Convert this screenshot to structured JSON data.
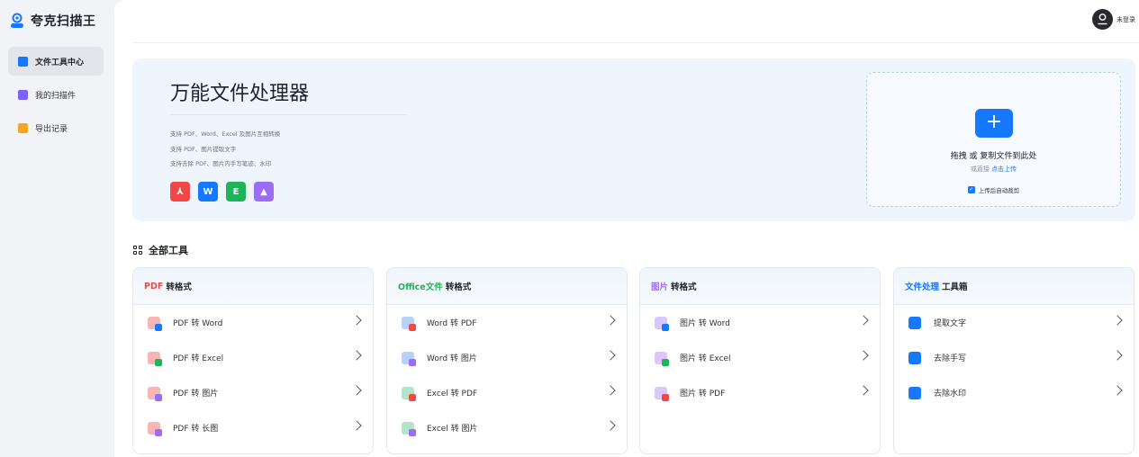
{
  "app": {
    "name": "夸克扫描王"
  },
  "sidebar": {
    "items": [
      {
        "label": "文件工具中心",
        "icon": "briefcase-icon",
        "active": true,
        "color": "#1677ff"
      },
      {
        "label": "我的扫描件",
        "icon": "document-icon",
        "active": false,
        "color": "#7b61ff"
      },
      {
        "label": "导出记录",
        "icon": "folder-icon",
        "active": false,
        "color": "#f5a623"
      }
    ]
  },
  "header": {
    "login_label": "未登录"
  },
  "hero": {
    "title": "万能文件处理器",
    "lines": [
      "支持 PDF、Word、Excel 及图片互相转换",
      "支持 PDF、图片提取文字",
      "支持去除 PDF、图片内手写笔迹、水印"
    ],
    "file_icons": [
      {
        "name": "pdf-icon",
        "glyph": "⅄",
        "color": "#f04848"
      },
      {
        "name": "word-icon",
        "glyph": "W",
        "color": "#1677ff"
      },
      {
        "name": "excel-icon",
        "glyph": "E",
        "color": "#1fb35a"
      },
      {
        "name": "image-icon",
        "glyph": "▲",
        "color": "#9b6cf5"
      }
    ]
  },
  "upload": {
    "main": "拖拽 或 复制文件到此处",
    "sub_prefix": "或直接 ",
    "sub_link": "点击上传",
    "checkbox_label": "上传后自动裁剪",
    "checked": true
  },
  "section": {
    "title": "全部工具"
  },
  "cards": [
    {
      "prefix": "PDF",
      "prefix_color": "#f04848",
      "suffix": "转格式",
      "items": [
        {
          "label": "PDF 转 Word",
          "icon": "pdf-to-word-icon",
          "base": "#f9b4b4",
          "sub": "#1677ff"
        },
        {
          "label": "PDF 转 Excel",
          "icon": "pdf-to-excel-icon",
          "base": "#f9b4b4",
          "sub": "#1fb35a"
        },
        {
          "label": "PDF 转 图片",
          "icon": "pdf-to-image-icon",
          "base": "#f9b4b4",
          "sub": "#9b6cf5"
        },
        {
          "label": "PDF 转 长图",
          "icon": "pdf-to-long-image-icon",
          "base": "#f9b4b4",
          "sub": "#9b6cf5"
        }
      ]
    },
    {
      "prefix": "Office文件",
      "prefix_color": "#1fb35a",
      "suffix": "转格式",
      "items": [
        {
          "label": "Word 转 PDF",
          "icon": "word-to-pdf-icon",
          "base": "#b6d2fb",
          "sub": "#f04848"
        },
        {
          "label": "Word 转 图片",
          "icon": "word-to-image-icon",
          "base": "#b6d2fb",
          "sub": "#9b6cf5"
        },
        {
          "label": "Excel 转 PDF",
          "icon": "excel-to-pdf-icon",
          "base": "#b3e6c6",
          "sub": "#f04848"
        },
        {
          "label": "Excel 转 图片",
          "icon": "excel-to-image-icon",
          "base": "#b3e6c6",
          "sub": "#9b6cf5"
        }
      ]
    },
    {
      "prefix": "图片",
      "prefix_color": "#9b6cf5",
      "suffix": "转格式",
      "items": [
        {
          "label": "图片 转 Word",
          "icon": "image-to-word-icon",
          "base": "#d8c8fb",
          "sub": "#1677ff"
        },
        {
          "label": "图片 转 Excel",
          "icon": "image-to-excel-icon",
          "base": "#d8c8fb",
          "sub": "#1fb35a"
        },
        {
          "label": "图片 转 PDF",
          "icon": "image-to-pdf-icon",
          "base": "#d8c8fb",
          "sub": "#f04848"
        }
      ]
    },
    {
      "prefix": "文件处理",
      "prefix_color": "#1677ff",
      "suffix": "工具箱",
      "items": [
        {
          "label": "提取文字",
          "icon": "extract-text-icon",
          "base": "#1677ff",
          "sub": ""
        },
        {
          "label": "去除手写",
          "icon": "remove-handwriting-icon",
          "base": "#1677ff",
          "sub": ""
        },
        {
          "label": "去除水印",
          "icon": "remove-watermark-icon",
          "base": "#1677ff",
          "sub": ""
        }
      ]
    }
  ]
}
